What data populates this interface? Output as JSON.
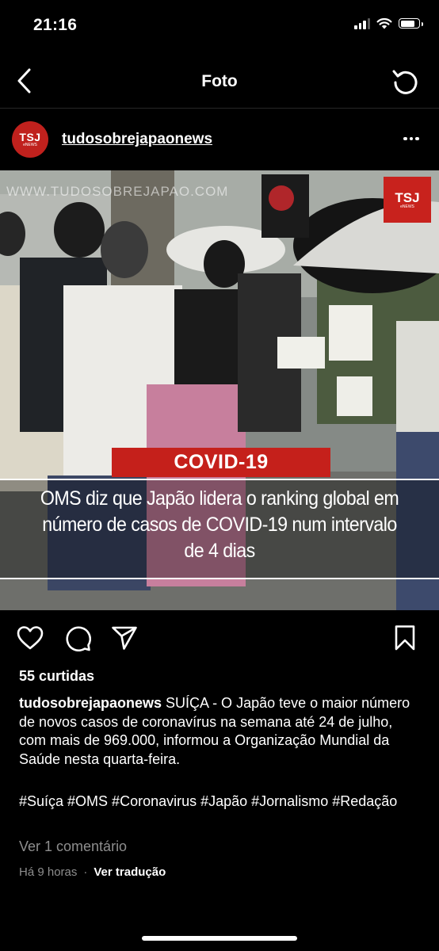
{
  "status_bar": {
    "time": "21:16",
    "signal_icon": "cellular-signal-icon",
    "wifi_icon": "wifi-icon",
    "battery_icon": "battery-icon",
    "battery_level": 0.8
  },
  "nav": {
    "back_icon": "chevron-left-icon",
    "title": "Foto",
    "refresh_icon": "refresh-icon"
  },
  "post": {
    "username": "tudosobrejapaonews",
    "avatar": {
      "abbr": "TSJ",
      "sub": "eNEWS",
      "color": "#c0211d"
    },
    "more_icon": "ellipsis-icon",
    "image": {
      "watermark": "WWW.TUDOSOBREJAPAO.COM",
      "logo": {
        "abbr": "TSJ",
        "sub": "eNEWS"
      },
      "tag": "COVID-19",
      "headline_lines": [
        "OMS diz que Japão lidera o ranking global em",
        "número de casos de COVID-19 num intervalo",
        "de 4 dias"
      ],
      "tag_color": "#c5201b"
    },
    "actions": {
      "like_icon": "heart-icon",
      "comment_icon": "comment-icon",
      "share_icon": "send-icon",
      "save_icon": "bookmark-icon"
    },
    "likes": "55 curtidas",
    "caption": {
      "user": "tudosobrejapaonews",
      "text": "SUÍÇA - O Japão teve o maior número de novos casos de coronavírus na semana até 24 de julho, com mais de 969.000, informou a Organização Mundial da Saúde nesta quarta-feira."
    },
    "hashtags": "#Suíça #OMS #Coronavirus #Japão #Jornalismo #Redação",
    "comments_link": "Ver 1 comentário",
    "time_ago": "Há 9 horas",
    "separator": "·",
    "translate": "Ver tradução"
  }
}
